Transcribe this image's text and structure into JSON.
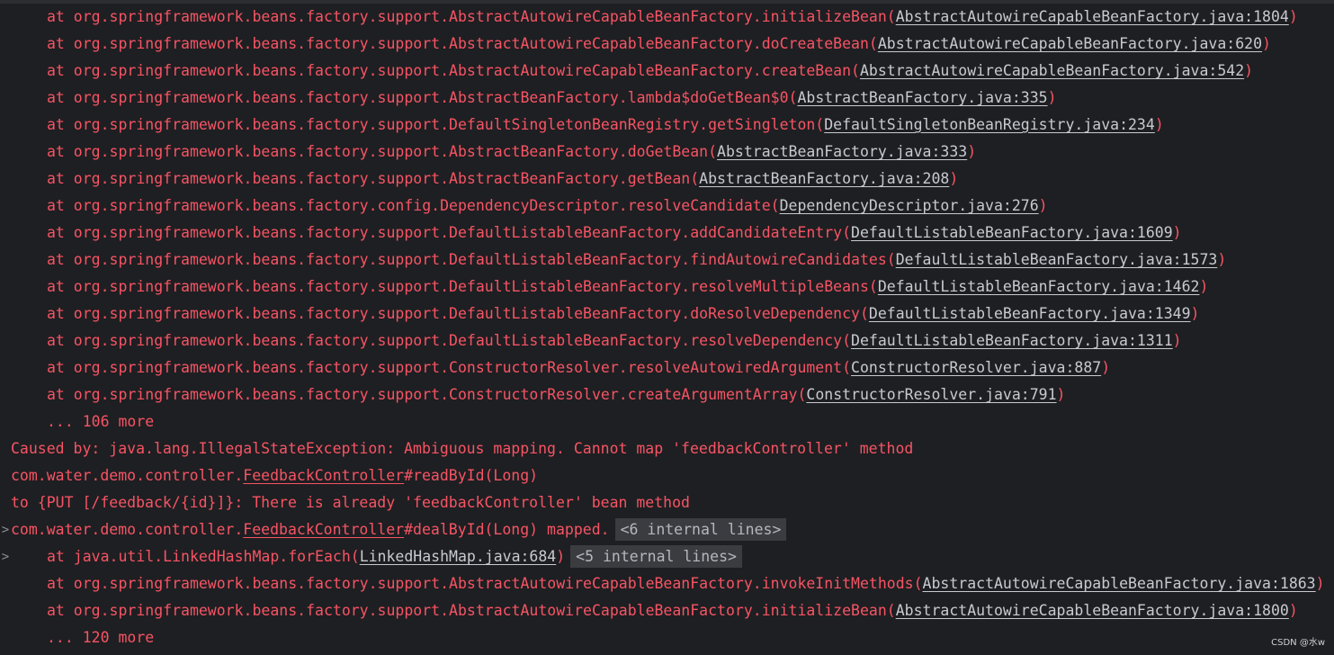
{
  "stack_top": [
    {
      "m": "at org.springframework.beans.factory.support.AbstractAutowireCapableBeanFactory.initializeBean(",
      "f": "AbstractAutowireCapableBeanFactory.java:1804"
    },
    {
      "m": "at org.springframework.beans.factory.support.AbstractAutowireCapableBeanFactory.doCreateBean(",
      "f": "AbstractAutowireCapableBeanFactory.java:620"
    },
    {
      "m": "at org.springframework.beans.factory.support.AbstractAutowireCapableBeanFactory.createBean(",
      "f": "AbstractAutowireCapableBeanFactory.java:542"
    },
    {
      "m": "at org.springframework.beans.factory.support.AbstractBeanFactory.lambda$doGetBean$0(",
      "f": "AbstractBeanFactory.java:335"
    },
    {
      "m": "at org.springframework.beans.factory.support.DefaultSingletonBeanRegistry.getSingleton(",
      "f": "DefaultSingletonBeanRegistry.java:234"
    },
    {
      "m": "at org.springframework.beans.factory.support.AbstractBeanFactory.doGetBean(",
      "f": "AbstractBeanFactory.java:333"
    },
    {
      "m": "at org.springframework.beans.factory.support.AbstractBeanFactory.getBean(",
      "f": "AbstractBeanFactory.java:208"
    },
    {
      "m": "at org.springframework.beans.factory.config.DependencyDescriptor.resolveCandidate(",
      "f": "DependencyDescriptor.java:276"
    },
    {
      "m": "at org.springframework.beans.factory.support.DefaultListableBeanFactory.addCandidateEntry(",
      "f": "DefaultListableBeanFactory.java:1609"
    },
    {
      "m": "at org.springframework.beans.factory.support.DefaultListableBeanFactory.findAutowireCandidates(",
      "f": "DefaultListableBeanFactory.java:1573"
    },
    {
      "m": "at org.springframework.beans.factory.support.DefaultListableBeanFactory.resolveMultipleBeans(",
      "f": "DefaultListableBeanFactory.java:1462"
    },
    {
      "m": "at org.springframework.beans.factory.support.DefaultListableBeanFactory.doResolveDependency(",
      "f": "DefaultListableBeanFactory.java:1349"
    },
    {
      "m": "at org.springframework.beans.factory.support.DefaultListableBeanFactory.resolveDependency(",
      "f": "DefaultListableBeanFactory.java:1311"
    },
    {
      "m": "at org.springframework.beans.factory.support.ConstructorResolver.resolveAutowiredArgument(",
      "f": "ConstructorResolver.java:887"
    },
    {
      "m": "at org.springframework.beans.factory.support.ConstructorResolver.createArgumentArray(",
      "f": "ConstructorResolver.java:791"
    }
  ],
  "more_1": "... 106 more",
  "caused_by": "Caused by: java.lang.IllegalStateException: Ambiguous mapping. Cannot map 'feedbackController' method",
  "line_readbyid": {
    "prefix": "com.water.demo.controller.",
    "cls": "FeedbackController",
    "suffix": "#readById(Long)"
  },
  "line_put": "to {PUT [/feedback/{id}]}: There is already 'feedbackController' bean method",
  "line_dealbyid": {
    "prefix": "com.water.demo.controller.",
    "cls": "FeedbackController",
    "suffix": "#dealById(Long) mapped.",
    "chip": "<6 internal lines>"
  },
  "line_foreach": {
    "m": "at java.util.LinkedHashMap.forEach(",
    "f": "LinkedHashMap.java:684",
    "chip": "<5 internal lines>"
  },
  "stack_bottom": [
    {
      "m": "at org.springframework.beans.factory.support.AbstractAutowireCapableBeanFactory.invokeInitMethods(",
      "f": "AbstractAutowireCapableBeanFactory.java:1863"
    },
    {
      "m": "at org.springframework.beans.factory.support.AbstractAutowireCapableBeanFactory.initializeBean(",
      "f": "AbstractAutowireCapableBeanFactory.java:1800"
    }
  ],
  "more_2": "... 120 more",
  "fold_icon": ">",
  "watermark": "CSDN @水w",
  "colors": {
    "background": "#1e1f22",
    "error_text": "#f75464",
    "link_text": "#c9cacf",
    "chip_bg": "#3a3c40"
  }
}
